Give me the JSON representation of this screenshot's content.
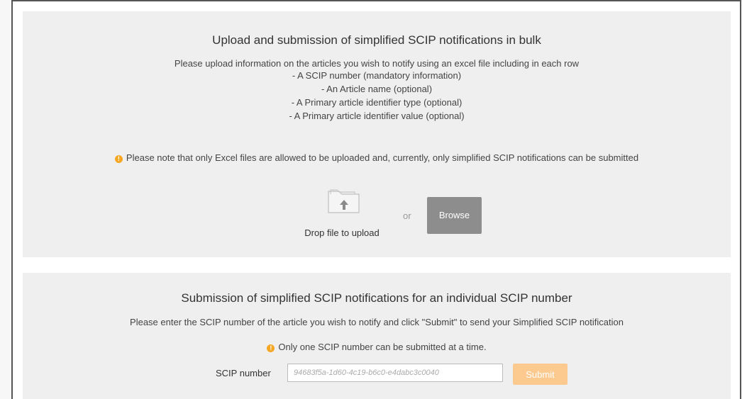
{
  "bulk": {
    "title": "Upload and submission of simplified SCIP notifications in bulk",
    "intro": "Please upload information on the articles you wish to notify using an excel file including in each row",
    "items": [
      "- A SCIP number (mandatory information)",
      "- An Article name (optional)",
      "- A Primary article identifier type (optional)",
      "- A Primary article identifier value (optional)"
    ],
    "note": "Please note that only Excel files are allowed to be uploaded and, currently, only simplified SCIP notifications can be submitted",
    "drop_label": "Drop file to upload",
    "or_label": "or",
    "browse_label": "Browse"
  },
  "single": {
    "title": "Submission of simplified SCIP notifications for an individual SCIP number",
    "instructions": "Please enter the SCIP number of the article you wish to notify and click \"Submit\" to send your Simplified SCIP notification",
    "note": "Only one SCIP number can be submitted at a time.",
    "field_label": "SCIP number",
    "placeholder": "94683f5a-1d60-4c19-b6c0-e4dabc3c0040",
    "submit_label": "Submit"
  },
  "colors": {
    "warning": "#f5a623",
    "browse_button": "#8d8d8d",
    "submit_button_disabled": "#fcc98f",
    "panel": "#efefef"
  }
}
